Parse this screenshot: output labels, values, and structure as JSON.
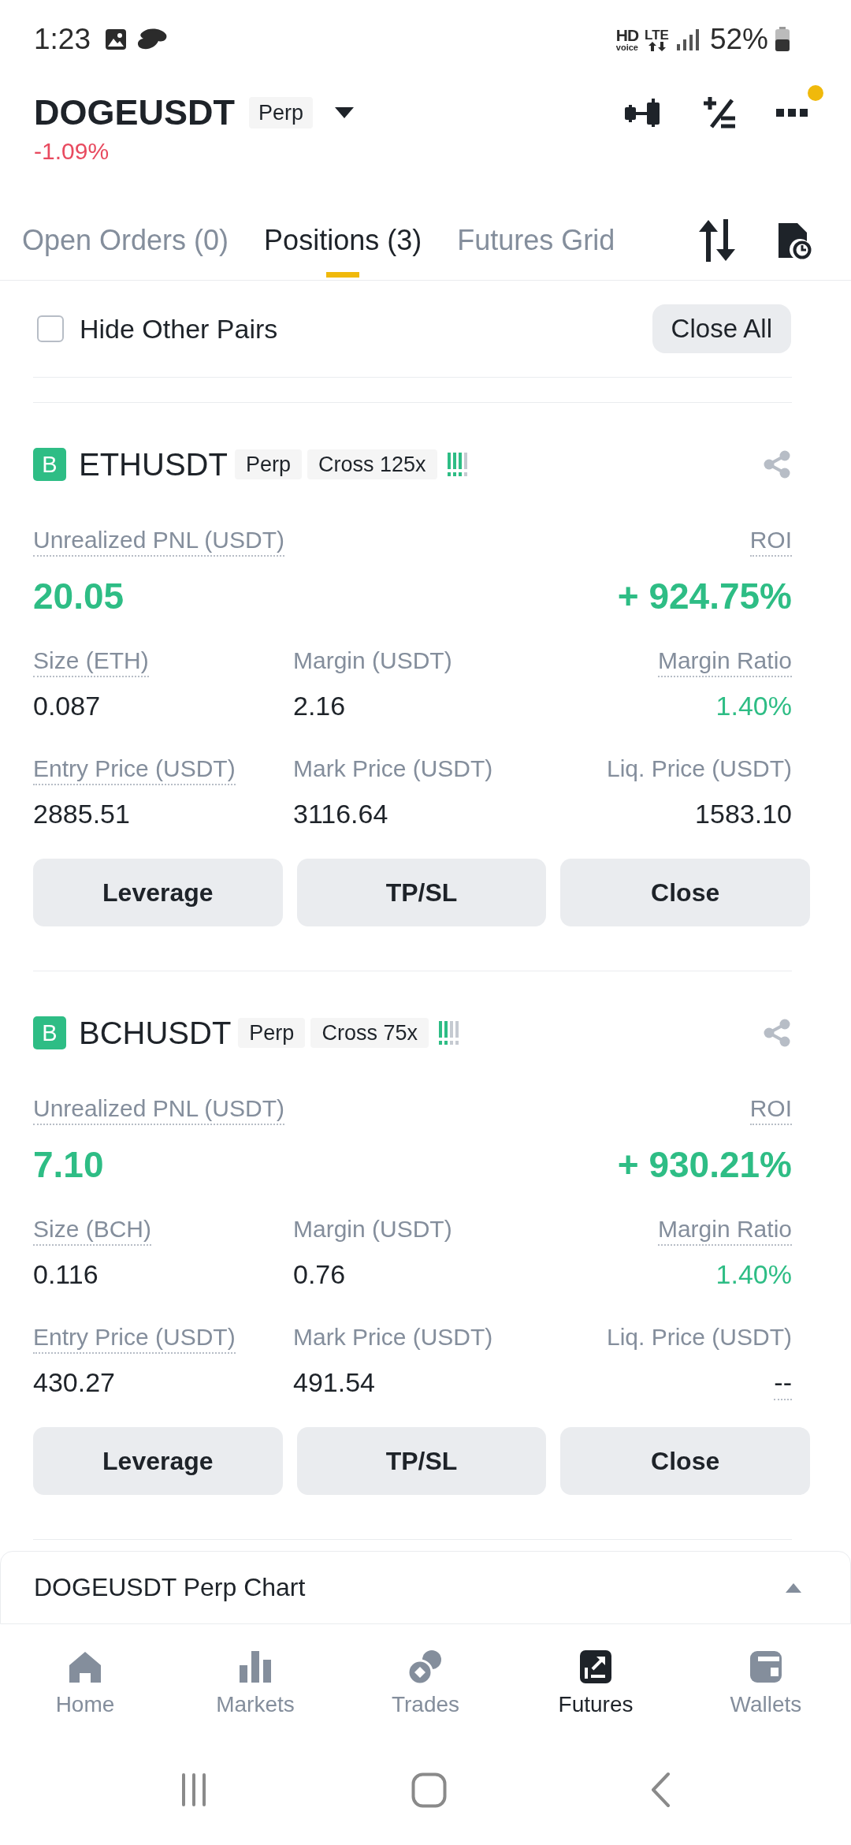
{
  "status_bar": {
    "time": "1:23",
    "call_label": {
      "main": "HD",
      "sub": "voice"
    },
    "network": "LTE",
    "battery": "52%"
  },
  "header": {
    "symbol": "DOGEUSDT",
    "tag": "Perp",
    "change": {
      "value": "-1.09%",
      "negative": true
    },
    "menu_badge": true
  },
  "tabs": [
    {
      "label": "Open Orders (0)",
      "selected": false
    },
    {
      "label": "Positions (3)",
      "selected": true
    },
    {
      "label": "Futures Grid",
      "selected": false
    }
  ],
  "filter": {
    "label": "Hide Other Pairs",
    "checked": false,
    "close_all": "Close All"
  },
  "positions": [
    {
      "side": "B",
      "symbol": "ETHUSDT",
      "tags": [
        "Perp",
        "Cross 125x"
      ],
      "adl": {
        "level": 0.75
      },
      "pnl": {
        "label": "Unrealized PNL (USDT)",
        "underlined": true,
        "value": "20.05",
        "positive": true
      },
      "roi": {
        "label": "ROI",
        "underlined": true,
        "value": "+ 924.75%",
        "positive": true
      },
      "fields": [
        {
          "label": "Size (ETH)",
          "underlined": true,
          "value": "0.087",
          "positive": false,
          "value_underlined": false
        },
        {
          "label": "Margin (USDT)",
          "underlined": false,
          "value": "2.16",
          "positive": false,
          "value_underlined": false
        },
        {
          "label": "Margin Ratio",
          "underlined": true,
          "value": "1.40%",
          "positive": true,
          "value_underlined": false
        },
        {
          "label": "Entry Price (USDT)",
          "underlined": true,
          "value": "2885.51",
          "positive": false,
          "value_underlined": false
        },
        {
          "label": "Mark Price (USDT)",
          "underlined": false,
          "value": "3116.64",
          "positive": false,
          "value_underlined": false
        },
        {
          "label": "Liq. Price (USDT)",
          "underlined": false,
          "value": "1583.10",
          "positive": false,
          "value_underlined": false
        }
      ],
      "actions": [
        "Leverage",
        "TP/SL",
        "Close"
      ]
    },
    {
      "side": "B",
      "symbol": "BCHUSDT",
      "tags": [
        "Perp",
        "Cross 75x"
      ],
      "adl": {
        "level": 0.5
      },
      "pnl": {
        "label": "Unrealized PNL (USDT)",
        "underlined": true,
        "value": "7.10",
        "positive": true
      },
      "roi": {
        "label": "ROI",
        "underlined": true,
        "value": "+ 930.21%",
        "positive": true
      },
      "fields": [
        {
          "label": "Size (BCH)",
          "underlined": true,
          "value": "0.116",
          "positive": false,
          "value_underlined": false
        },
        {
          "label": "Margin (USDT)",
          "underlined": false,
          "value": "0.76",
          "positive": false,
          "value_underlined": false
        },
        {
          "label": "Margin Ratio",
          "underlined": true,
          "value": "1.40%",
          "positive": true,
          "value_underlined": false
        },
        {
          "label": "Entry Price (USDT)",
          "underlined": true,
          "value": "430.27",
          "positive": false,
          "value_underlined": false
        },
        {
          "label": "Mark Price (USDT)",
          "underlined": false,
          "value": "491.54",
          "positive": false,
          "value_underlined": false
        },
        {
          "label": "Liq. Price (USDT)",
          "underlined": false,
          "value": "--",
          "positive": false,
          "value_underlined": true
        }
      ],
      "actions": [
        "Leverage",
        "TP/SL",
        "Close"
      ]
    }
  ],
  "chart_panel": {
    "title": "DOGEUSDT Perp Chart",
    "expanded": false
  },
  "nav": [
    {
      "label": "Home",
      "selected": false
    },
    {
      "label": "Markets",
      "selected": false
    },
    {
      "label": "Trades",
      "selected": false
    },
    {
      "label": "Futures",
      "selected": true
    },
    {
      "label": "Wallets",
      "selected": false
    }
  ]
}
